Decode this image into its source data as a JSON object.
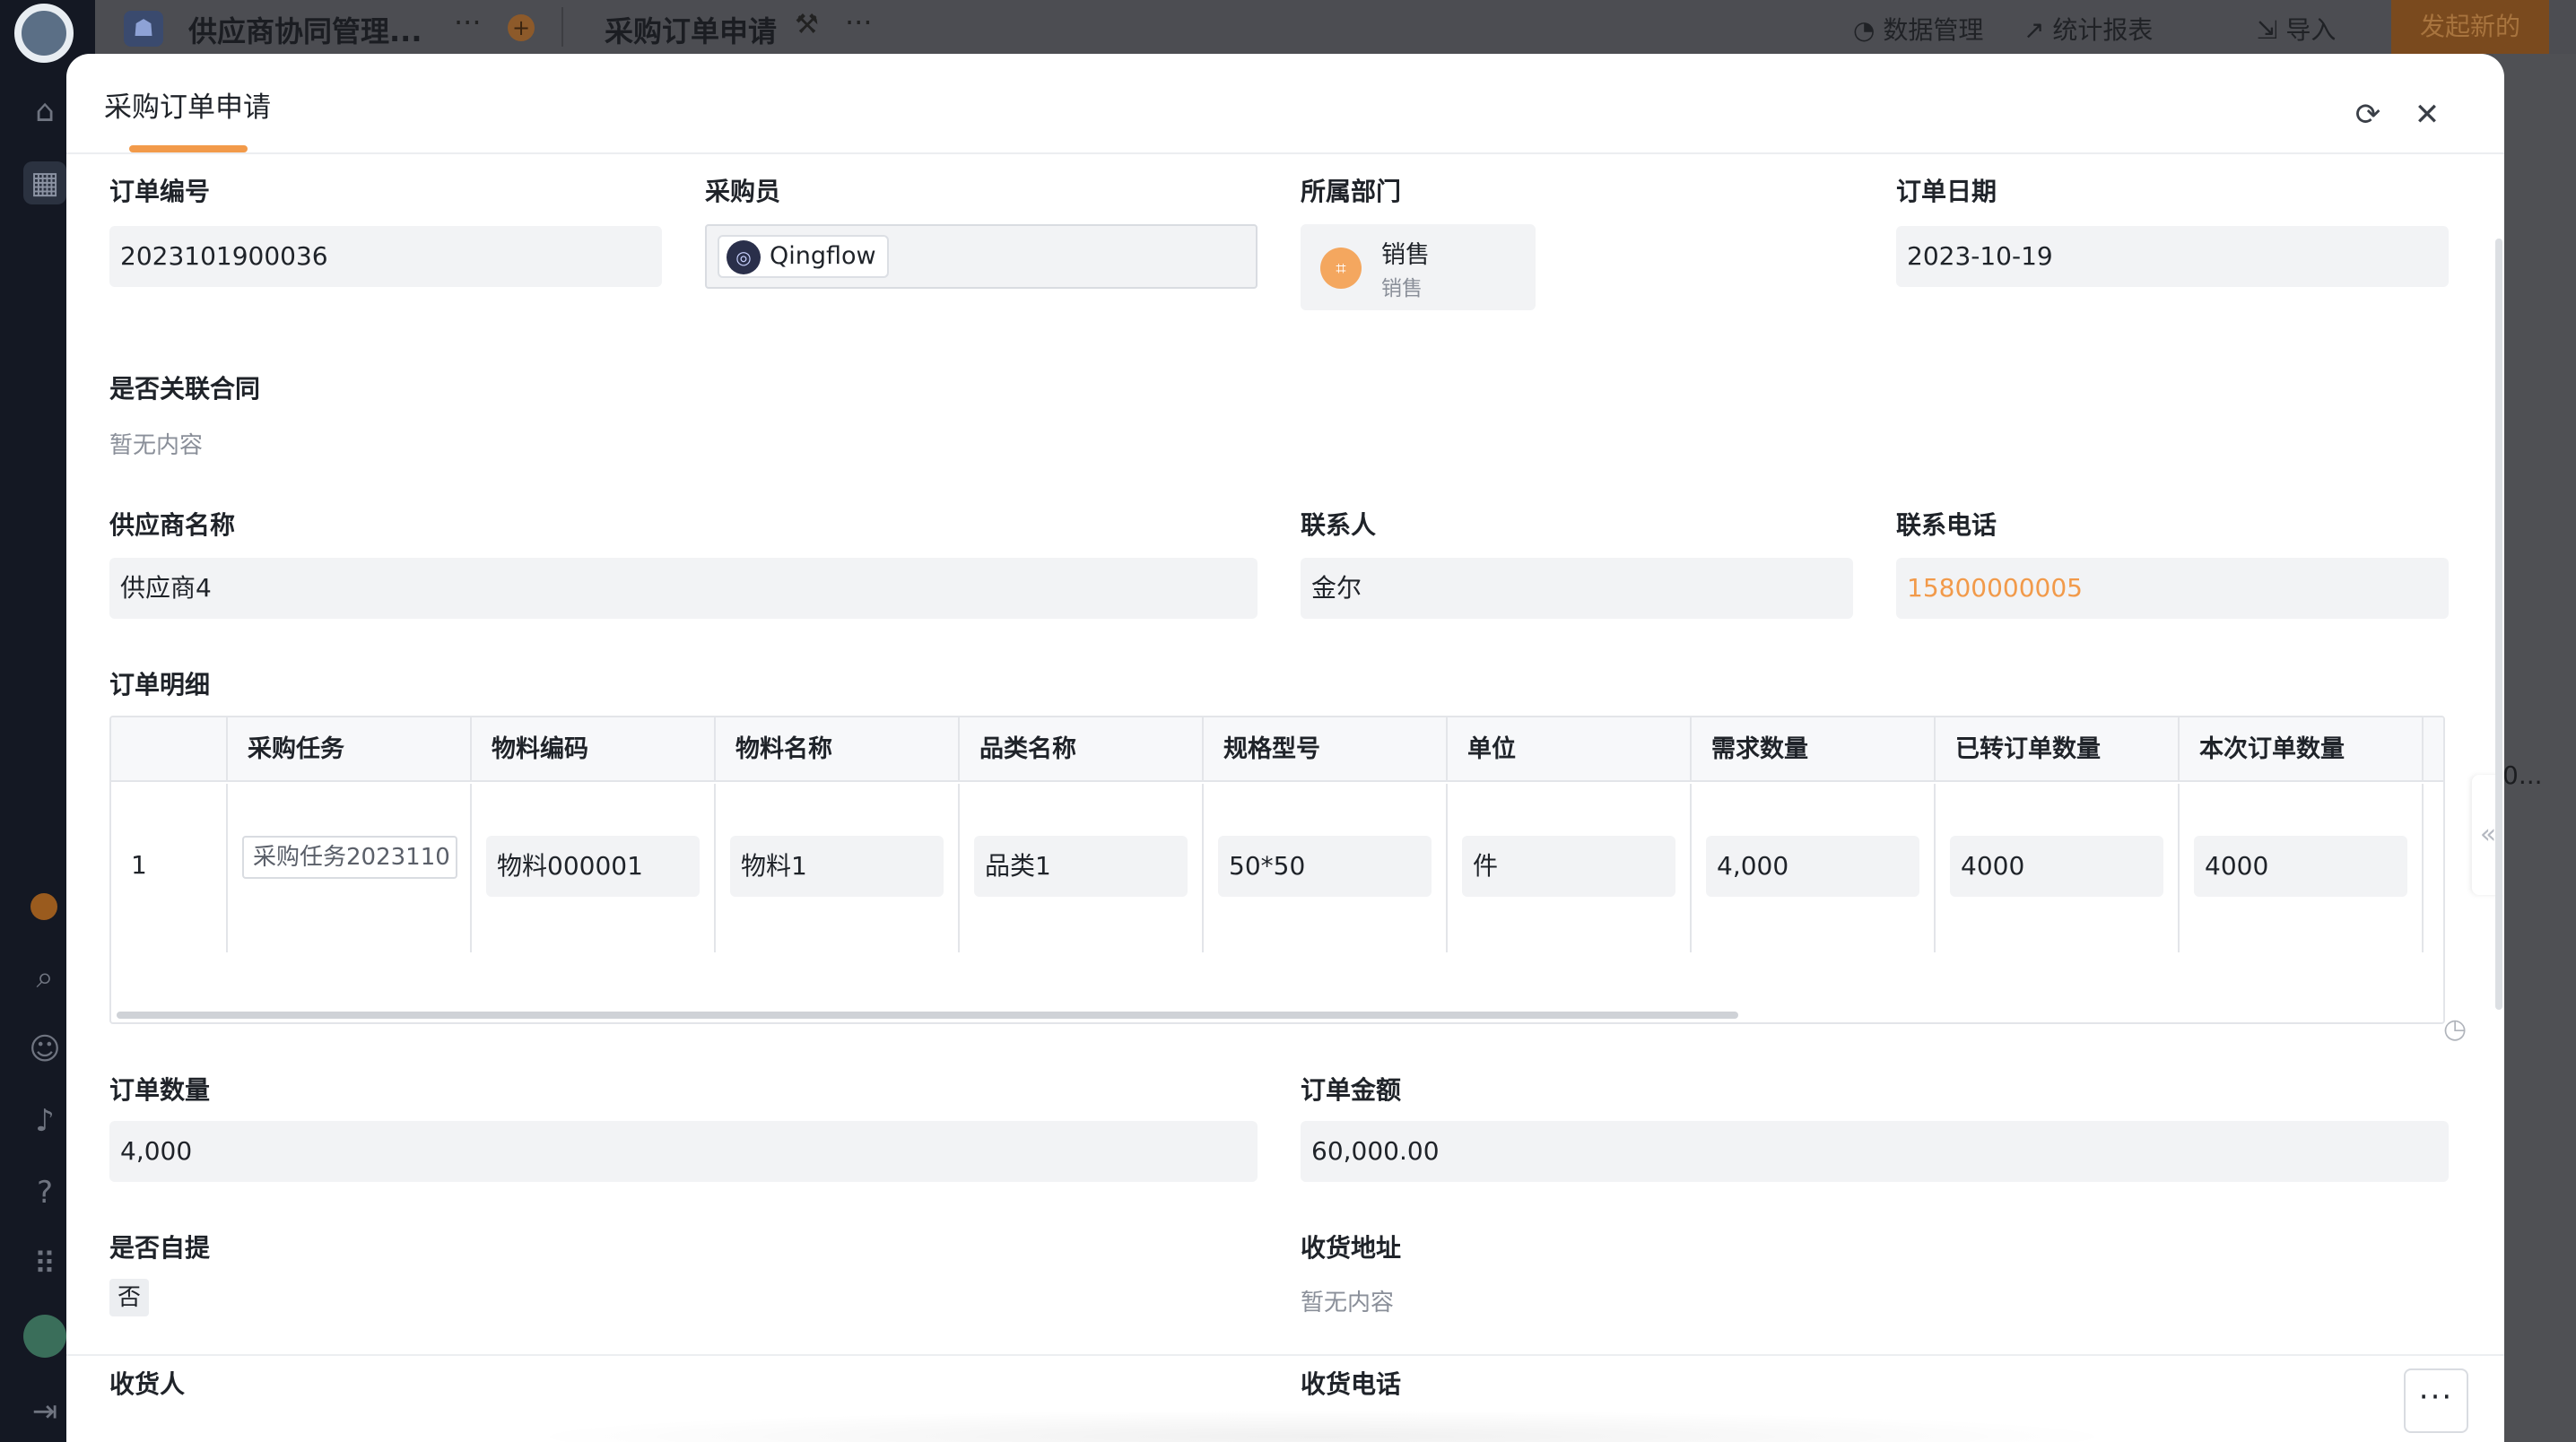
{
  "background": {
    "app_title": "供应商协同管理...",
    "form_title": "采购订单申请",
    "links": {
      "data_manage": "数据管理",
      "reports": "统计报表",
      "import": "导入"
    },
    "start_button": "发起新的",
    "right_panel_ellipsis": "0..."
  },
  "modal": {
    "title": "采购订单申请",
    "colors": {
      "accent": "#f29a4a",
      "field_bg": "#f2f3f5"
    }
  },
  "fields": {
    "order_no": {
      "label": "订单编号",
      "value": "2023101900036"
    },
    "buyer": {
      "label": "采购员",
      "value": "Qingflow"
    },
    "department": {
      "label": "所属部门",
      "name": "销售",
      "sub": "销售"
    },
    "order_date": {
      "label": "订单日期",
      "value": "2023-10-19"
    },
    "link_contract": {
      "label": "是否关联合同",
      "value": "暂无内容"
    },
    "supplier": {
      "label": "供应商名称",
      "value": "供应商4"
    },
    "contact": {
      "label": "联系人",
      "value": "金尔"
    },
    "phone": {
      "label": "联系电话",
      "value": "15800000005"
    },
    "order_detail_label": "订单明细",
    "order_qty": {
      "label": "订单数量",
      "value": "4,000"
    },
    "order_amount": {
      "label": "订单金额",
      "value": "60,000.00"
    },
    "self_pickup": {
      "label": "是否自提",
      "value": "否"
    },
    "address": {
      "label": "收货地址",
      "value": "暂无内容"
    },
    "receiver": {
      "label": "收货人"
    },
    "receiver_phone": {
      "label": "收货电话"
    }
  },
  "table": {
    "headers": [
      "采购任务",
      "物料编码",
      "物料名称",
      "品类名称",
      "规格型号",
      "单位",
      "需求数量",
      "已转订单数量",
      "本次订单数量"
    ],
    "row": {
      "index": "1",
      "task": "采购任务2023110",
      "material_code": "物料000001",
      "material_name": "物料1",
      "category": "品类1",
      "spec": "50*50",
      "unit": "件",
      "demand_qty": "4,000",
      "converted_qty": "4000",
      "this_qty": "4000"
    }
  },
  "footer": {
    "more": "···"
  }
}
